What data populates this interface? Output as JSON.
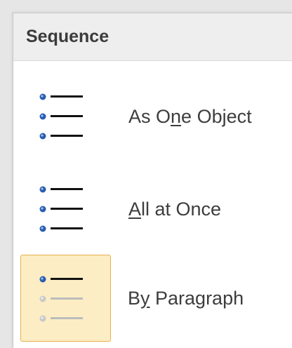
{
  "panel": {
    "title": "Sequence"
  },
  "options": [
    {
      "label_pre": "As O",
      "label_key": "n",
      "label_post": "e Object",
      "icon": "bulleted-list-icon",
      "selected": false
    },
    {
      "label_pre": "",
      "label_key": "A",
      "label_post": "ll at Once",
      "icon": "bulleted-list-icon",
      "selected": false
    },
    {
      "label_pre": "B",
      "label_key": "y",
      "label_post": " Paragraph",
      "icon": "bulleted-list-partial-icon",
      "selected": true
    }
  ],
  "colors": {
    "bullet_blue": "#2a5db0",
    "selected_bg": "#fcedc4",
    "selected_border": "#e8b04f",
    "dim": "#bcbcbc"
  }
}
